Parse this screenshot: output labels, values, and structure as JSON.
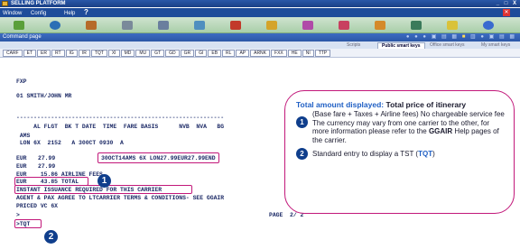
{
  "window": {
    "title": "SELLING PLATFORM",
    "controls": "_ □ X"
  },
  "menu": {
    "items": [
      "Window",
      "Config"
    ],
    "help": "Help",
    "help_icon": "?"
  },
  "toolbar": {
    "icons": [
      "home-icon",
      "globe-icon",
      "person-icon",
      "car-icon",
      "plane-icon",
      "car-icon",
      "hotel-icon",
      "pencil-icon",
      "hourglass-icon",
      "calendar-icon",
      "person-icon",
      "rail-icon",
      "document-icon",
      "pie-icon"
    ]
  },
  "command_page": {
    "label": "Command page"
  },
  "smart_tabs": {
    "scripts": "Scripts",
    "public": "Public smart keys",
    "office": "Office smart keys",
    "my": "My smart keys"
  },
  "keys": [
    "CARF",
    "ET",
    "ER",
    "RT",
    "IG",
    "IR",
    "TQT",
    "XI",
    "MD",
    "MU",
    "GT",
    "GD",
    "GR",
    "GI",
    "EB",
    "RL",
    "AP",
    "ARNK",
    "FXX",
    "HE",
    "NI",
    "TTP"
  ],
  "terminal": {
    "line1": "FXP",
    "line2": "01 SMITH/JOHN MR",
    "dashes": "------------------------------------------------------------",
    "header": "     AL FLGT  BK T DATE  TIME  FARE BASIS      NVB  NVA   BG",
    "origin": " AMS",
    "segment": " LON 6X  2152   A 300CT 0930  A",
    "fare_ccy": "EUR",
    "fare_amt": "27.99",
    "fare_calc": "30OCT14AMS 6X LON27.99EUR27.99END",
    "equiv_ccy": "EUR",
    "equiv_amt": "27.99",
    "tax_line": "EUR    15.86 AIRLINE FEES",
    "total_line": "EUR    43.85 TOTAL",
    "issue_line": "INSTANT ISSUANCE REQUIRED FOR THIS CARRIER",
    "agree_line": "AGENT & PAX AGREE TO LTCARRIER TERMS & CONDITIONS- SEE GGAIR",
    "priced_line": "PRICED VC 6X",
    "prompt": ">",
    "page": "PAGE  2/ 2",
    "cmd": ">TQT"
  },
  "markers": {
    "one": "1",
    "two": "2"
  },
  "callout": {
    "title_blue": "Total amount displayed:",
    "title_rest": " Total price of itinerary",
    "item1_a": "(Base fare + Taxes + Airline fees) No chargeable service fee",
    "item1_b": "The currency may vary from one carrier to the other, for more information please refer to the ",
    "item1_bold": "GGAIR",
    "item1_c": " Help pages of the carrier.",
    "item2_a": "Standard entry to display a TST (",
    "item2_cmd": "TQT",
    "item2_b": ")"
  },
  "colors": {
    "accent": "#c2187a",
    "marker": "#0f3e8c",
    "link": "#1f5fc4",
    "terminal_text": "#1c2a66"
  }
}
